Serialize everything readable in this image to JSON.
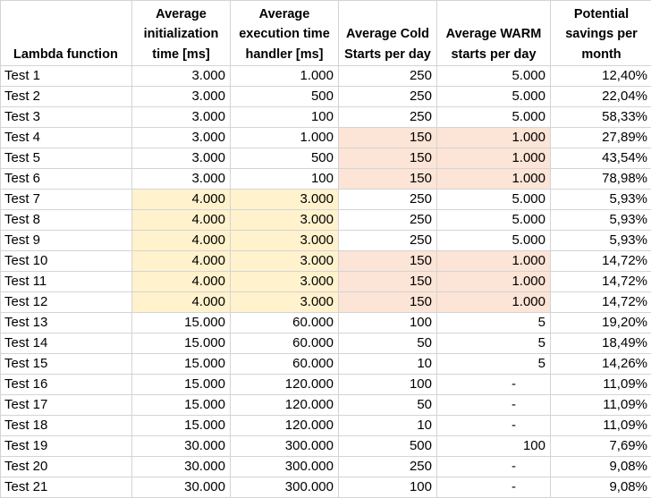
{
  "sheet": {
    "headers": [
      "Lambda function",
      "Average\ninitialization\ntime [ms]",
      "Average\nexecution time\nhandler [ms]",
      "Average Cold\nStarts per day",
      "Average WARM\nstarts per day",
      "Potential\nsavings per\nmonth"
    ],
    "rows": [
      {
        "name": "Test 1",
        "init": "3.000",
        "exec": "1.000",
        "cold": "250",
        "warm": "5.000",
        "savings": "12,40%",
        "hl_init_exec": false,
        "hl_cold_warm": false
      },
      {
        "name": "Test 2",
        "init": "3.000",
        "exec": "500",
        "cold": "250",
        "warm": "5.000",
        "savings": "22,04%",
        "hl_init_exec": false,
        "hl_cold_warm": false
      },
      {
        "name": "Test 3",
        "init": "3.000",
        "exec": "100",
        "cold": "250",
        "warm": "5.000",
        "savings": "58,33%",
        "hl_init_exec": false,
        "hl_cold_warm": false
      },
      {
        "name": "Test 4",
        "init": "3.000",
        "exec": "1.000",
        "cold": "150",
        "warm": "1.000",
        "savings": "27,89%",
        "hl_init_exec": false,
        "hl_cold_warm": true
      },
      {
        "name": "Test 5",
        "init": "3.000",
        "exec": "500",
        "cold": "150",
        "warm": "1.000",
        "savings": "43,54%",
        "hl_init_exec": false,
        "hl_cold_warm": true
      },
      {
        "name": "Test 6",
        "init": "3.000",
        "exec": "100",
        "cold": "150",
        "warm": "1.000",
        "savings": "78,98%",
        "hl_init_exec": false,
        "hl_cold_warm": true
      },
      {
        "name": "Test 7",
        "init": "4.000",
        "exec": "3.000",
        "cold": "250",
        "warm": "5.000",
        "savings": "5,93%",
        "hl_init_exec": true,
        "hl_cold_warm": false
      },
      {
        "name": "Test 8",
        "init": "4.000",
        "exec": "3.000",
        "cold": "250",
        "warm": "5.000",
        "savings": "5,93%",
        "hl_init_exec": true,
        "hl_cold_warm": false
      },
      {
        "name": "Test 9",
        "init": "4.000",
        "exec": "3.000",
        "cold": "250",
        "warm": "5.000",
        "savings": "5,93%",
        "hl_init_exec": true,
        "hl_cold_warm": false
      },
      {
        "name": "Test 10",
        "init": "4.000",
        "exec": "3.000",
        "cold": "150",
        "warm": "1.000",
        "savings": "14,72%",
        "hl_init_exec": true,
        "hl_cold_warm": true
      },
      {
        "name": "Test 11",
        "init": "4.000",
        "exec": "3.000",
        "cold": "150",
        "warm": "1.000",
        "savings": "14,72%",
        "hl_init_exec": true,
        "hl_cold_warm": true
      },
      {
        "name": "Test 12",
        "init": "4.000",
        "exec": "3.000",
        "cold": "150",
        "warm": "1.000",
        "savings": "14,72%",
        "hl_init_exec": true,
        "hl_cold_warm": true
      },
      {
        "name": "Test 13",
        "init": "15.000",
        "exec": "60.000",
        "cold": "100",
        "warm": "5",
        "savings": "19,20%",
        "hl_init_exec": false,
        "hl_cold_warm": false
      },
      {
        "name": "Test 14",
        "init": "15.000",
        "exec": "60.000",
        "cold": "50",
        "warm": "5",
        "savings": "18,49%",
        "hl_init_exec": false,
        "hl_cold_warm": false
      },
      {
        "name": "Test 15",
        "init": "15.000",
        "exec": "60.000",
        "cold": "10",
        "warm": "5",
        "savings": "14,26%",
        "hl_init_exec": false,
        "hl_cold_warm": false
      },
      {
        "name": "Test 16",
        "init": "15.000",
        "exec": "120.000",
        "cold": "100",
        "warm": "-",
        "savings": "11,09%",
        "hl_init_exec": false,
        "hl_cold_warm": false
      },
      {
        "name": "Test 17",
        "init": "15.000",
        "exec": "120.000",
        "cold": "50",
        "warm": "-",
        "savings": "11,09%",
        "hl_init_exec": false,
        "hl_cold_warm": false
      },
      {
        "name": "Test 18",
        "init": "15.000",
        "exec": "120.000",
        "cold": "10",
        "warm": "-",
        "savings": "11,09%",
        "hl_init_exec": false,
        "hl_cold_warm": false
      },
      {
        "name": "Test 19",
        "init": "30.000",
        "exec": "300.000",
        "cold": "500",
        "warm": "100",
        "savings": "7,69%",
        "hl_init_exec": false,
        "hl_cold_warm": false
      },
      {
        "name": "Test 20",
        "init": "30.000",
        "exec": "300.000",
        "cold": "250",
        "warm": "-",
        "savings": "9,08%",
        "hl_init_exec": false,
        "hl_cold_warm": false
      },
      {
        "name": "Test 21",
        "init": "30.000",
        "exec": "300.000",
        "cold": "100",
        "warm": "-",
        "savings": "9,08%",
        "hl_init_exec": false,
        "hl_cold_warm": false
      }
    ],
    "colors": {
      "highlight_yellow": "#fff2cc",
      "highlight_peach": "#fce4d6",
      "gridline": "#d4d4d4"
    }
  }
}
